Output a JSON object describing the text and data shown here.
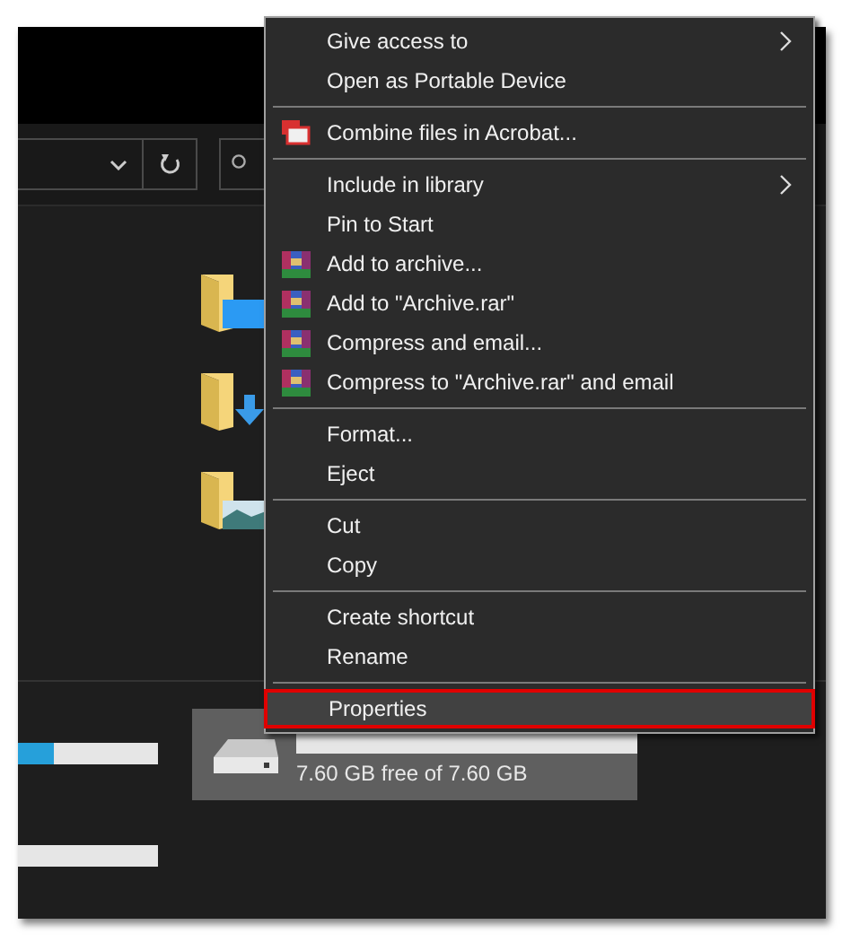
{
  "drives": [
    {
      "level": 0.25,
      "selected": false
    },
    {
      "selected": false
    },
    {
      "selected": true,
      "space": "7.60 GB free of 7.60 GB"
    }
  ],
  "context_menu": {
    "items": [
      {
        "kind": "item",
        "label": "Give access to",
        "submenu": true,
        "selected": false
      },
      {
        "kind": "item",
        "label": "Open as Portable Device",
        "submenu": false,
        "selected": false
      },
      {
        "kind": "separator"
      },
      {
        "kind": "acrobat",
        "label": "Combine files in Acrobat...",
        "submenu": false,
        "selected": false
      },
      {
        "kind": "separator"
      },
      {
        "kind": "item",
        "label": "Include in library",
        "submenu": true,
        "selected": false
      },
      {
        "kind": "item",
        "label": "Pin to Start",
        "submenu": false,
        "selected": false
      },
      {
        "kind": "archive",
        "label": "Add to archive...",
        "submenu": false,
        "selected": false
      },
      {
        "kind": "archive",
        "label": "Add to \"Archive.rar\"",
        "submenu": false,
        "selected": false
      },
      {
        "kind": "archive",
        "label": "Compress and email...",
        "submenu": false,
        "selected": false
      },
      {
        "kind": "archive",
        "label": "Compress to \"Archive.rar\" and email",
        "submenu": false,
        "selected": false
      },
      {
        "kind": "separator"
      },
      {
        "kind": "item",
        "label": "Format...",
        "submenu": false,
        "selected": false
      },
      {
        "kind": "item",
        "label": "Eject",
        "submenu": false,
        "selected": false
      },
      {
        "kind": "separator"
      },
      {
        "kind": "item",
        "label": "Cut",
        "submenu": false,
        "selected": false
      },
      {
        "kind": "item",
        "label": "Copy",
        "submenu": false,
        "selected": false
      },
      {
        "kind": "separator"
      },
      {
        "kind": "item",
        "label": "Create shortcut",
        "submenu": false,
        "selected": false
      },
      {
        "kind": "item",
        "label": "Rename",
        "submenu": false,
        "selected": false
      },
      {
        "kind": "separator"
      },
      {
        "kind": "item",
        "label": "Properties",
        "submenu": false,
        "selected": true
      }
    ]
  }
}
